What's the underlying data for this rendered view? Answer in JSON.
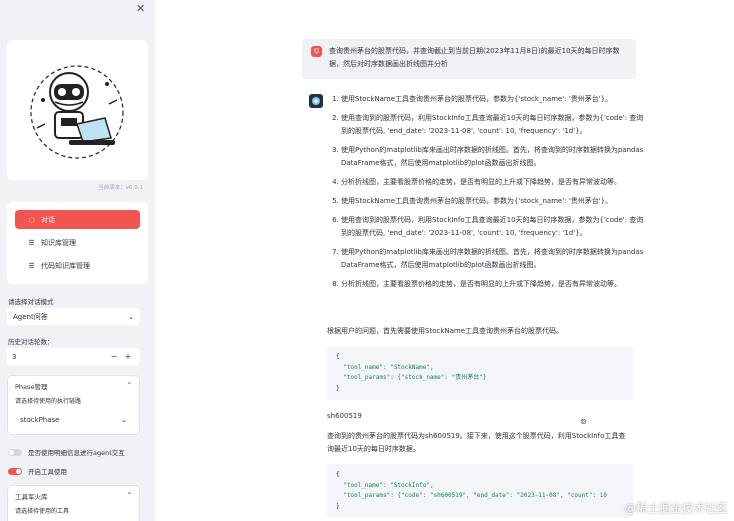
{
  "sidebar": {
    "version_label": "当前版本：v0.0.1",
    "nav": [
      {
        "label": "对话",
        "icon": "chat-icon",
        "active": true
      },
      {
        "label": "知识库管理",
        "icon": "list-icon",
        "active": false
      },
      {
        "label": "代码知识库管理",
        "icon": "list-icon",
        "active": false
      }
    ],
    "mode_label": "请选择对话模式",
    "mode_value": "Agent问答",
    "history_label": "历史对话轮数：",
    "history_value": "3",
    "phase": {
      "title": "Phase管理",
      "select_label": "请选择待使用的执行链路",
      "select_value": "stockPhase"
    },
    "toggle_detail_label": "是否使用明细信息进行agent交互",
    "toggle_tool_label": "开启工具使用",
    "toolbox": {
      "title": "工具军火库",
      "select_label": "请选择待使用的工具"
    }
  },
  "chat": {
    "user_message": "查询贵州茅台的股票代码，并查询截止到当前日期(2023年11月8日)的最近10天的每日时序数据，然后对时序数据画出折线图并分析",
    "steps": [
      "使用StockName工具查询贵州茅台的股票代码，参数为{'stock_name': '贵州茅台'}。",
      "使用查询到的股票代码，利用StockInfo工具查询最近10天的每日时序数据，参数为{'code': 查询到的股票代码, 'end_date': '2023-11-08', 'count': 10, 'frequency': '1d'}。",
      "使用Python的matplotlib库来画出时序数据的折线图。首先，将查询到的时序数据转换为pandas DataFrame格式，然后使用matplotlib的plot函数画出折线图。",
      "分析折线图，主要看股票价格的走势，是否有明显的上升或下降趋势，是否有异常波动等。",
      "使用StockName工具查询贵州茅台的股票代码，参数为{'stock_name': '贵州茅台'}。",
      "使用查询到的股票代码，利用StockInfo工具查询最近10天的每日时序数据，参数为{'code': 查询到的股票代码, 'end_date': '2023-11-08', 'count': 10, 'frequency': '1d'}。",
      "使用Python的matplotlib库来画出时序数据的折线图。首先，将查询到的时序数据转换为pandas DataFrame格式，然后使用matplotlib的plot函数画出折线图。",
      "分析折线图，主要看股票价格的走势，是否有明显的上升或下降趋势，是否有异常波动等。"
    ],
    "para1": "根据用户的问题，首先需要使用StockName工具查询贵州茅台的股票代码。",
    "code1": {
      "open": "{",
      "tool_name_key": "\"tool_name\": ",
      "tool_name_val": "\"StockName\",",
      "tool_params_key": "\"tool_params\": ",
      "tool_params_val": "{\"stock_name\": \"贵州茅台\"}",
      "close": "}"
    },
    "result1": "sh600519",
    "para2": "查询到的贵州茅台的股票代码为sh600519。接下来，使用这个股票代码，利用StockInfo工具查询最近10天的每日时序数据。",
    "code2": {
      "open": "{",
      "tool_name_key": "\"tool_name\": ",
      "tool_name_val": "\"StockInfo\",",
      "tool_params_key": "\"tool_params\": ",
      "tool_params_val": "{\"code\": \"sh600519\", \"end_date\": \"2023-11-08\", \"count\": 10",
      "close": "}"
    }
  },
  "watermark": "@稀土掘金技术社区",
  "colors": {
    "accent": "#f0554f",
    "sidebar_bg": "#f0f2f6"
  }
}
